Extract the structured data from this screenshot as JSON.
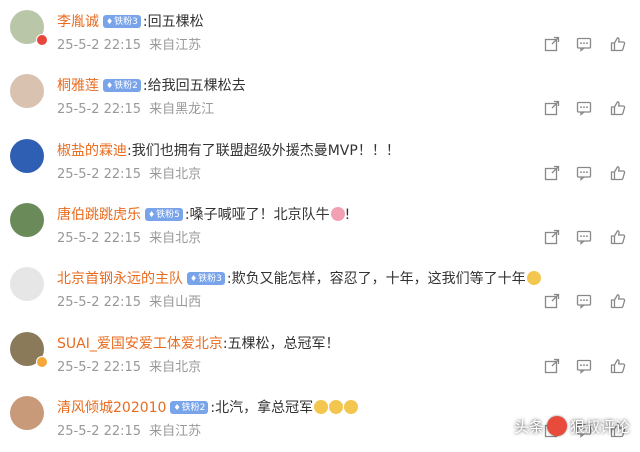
{
  "comments": [
    {
      "username": "李胤诚",
      "fan_badge": "铁粉3",
      "prefix": ":",
      "text": "回五棵松",
      "emoji": false,
      "date": "25-5-2 22:15",
      "location": "来自江苏",
      "avatar_color": "#b9c6a8",
      "vip": "red"
    },
    {
      "username": "桐雅莲",
      "fan_badge": "铁粉2",
      "prefix": ":",
      "text": "给我回五棵松去",
      "emoji": false,
      "date": "25-5-2 22:15",
      "location": "来自黑龙江",
      "avatar_color": "#d9c2b0",
      "vip": ""
    },
    {
      "username": "椒盐的霖迪",
      "fan_badge": "",
      "prefix": ":",
      "text": "我们也拥有了联盟超级外援杰曼MVP！！！",
      "emoji": false,
      "date": "25-5-2 22:15",
      "location": "来自北京",
      "avatar_color": "#2f5fb3",
      "vip": ""
    },
    {
      "username": "唐伯跳跳虎乐",
      "fan_badge": "铁粉5",
      "prefix": ":",
      "text": "嗓子喊哑了！北京队牛",
      "emoji": "pink",
      "date": "25-5-2 22:15",
      "location": "来自北京",
      "avatar_color": "#6b8a5a",
      "vip": ""
    },
    {
      "username": "北京首钢永远的主队",
      "fan_badge": "铁粉3",
      "prefix": ":",
      "text": "欺负又能怎样，容忍了，十年，这我们等了十年",
      "emoji": "yellow",
      "date": "25-5-2 22:15",
      "location": "来自山西",
      "avatar_color": "#e6e6e6",
      "vip": ""
    },
    {
      "username": "SUAI_爱国安爱工体爱北京",
      "fan_badge": "",
      "prefix": ":",
      "text": "五棵松，总冠军！",
      "emoji": false,
      "date": "25-5-2 22:15",
      "location": "来自北京",
      "avatar_color": "#8a7a5a",
      "vip": "orange"
    },
    {
      "username": "清风倾城202010",
      "fan_badge": "铁粉2",
      "prefix": ":",
      "text": "北汽，拿总冠军",
      "emoji": "triple",
      "date": "25-5-2 22:15",
      "location": "来自江苏",
      "avatar_color": "#c89a7a",
      "vip": ""
    }
  ],
  "watermark": {
    "left": "头条",
    "right": "狠叔评论"
  },
  "colors": {
    "username": "#e86b1f",
    "fan_badge": "#79a4ea",
    "meta": "#999999",
    "icon": "#888888"
  },
  "icons": {
    "share": "share-icon",
    "reply": "comment-icon",
    "like": "thumbs-up-icon"
  }
}
